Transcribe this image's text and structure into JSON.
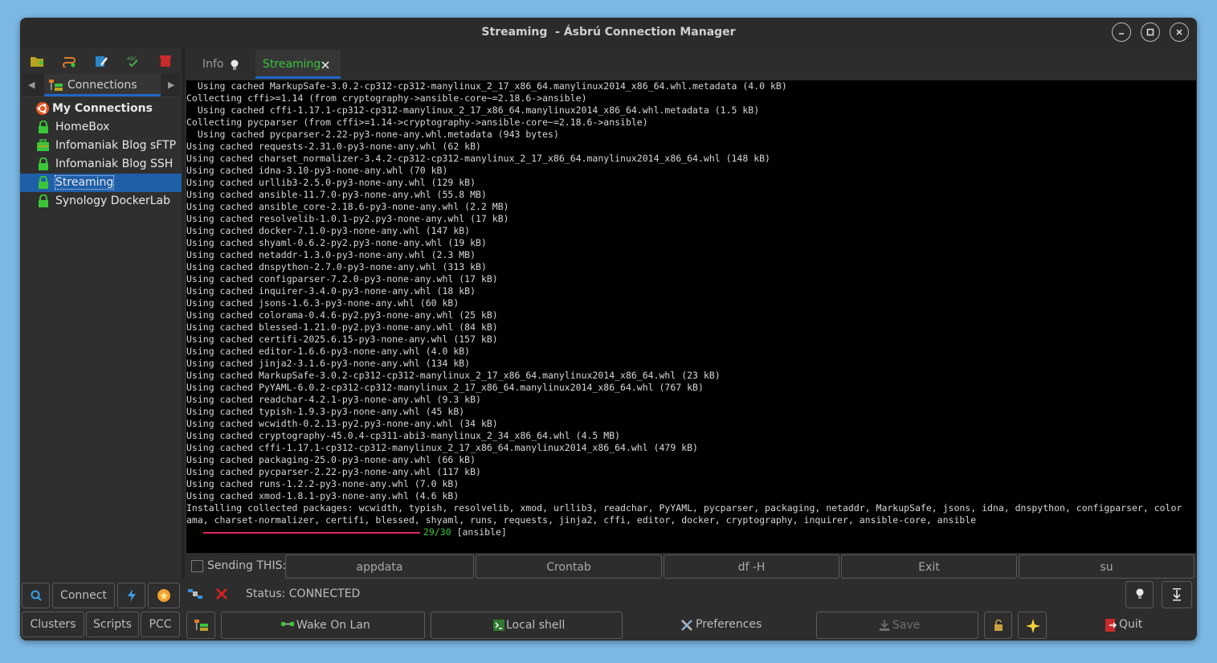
{
  "window": {
    "title": "Streaming  - Ásbrú Connection Manager"
  },
  "sidebar": {
    "tab_label": "Connections",
    "tree": {
      "root": "My Connections",
      "items": [
        {
          "label": "HomeBox",
          "icon": "lock-icon"
        },
        {
          "label": "Infomaniak Blog sFTP",
          "icon": "sftp-icon"
        },
        {
          "label": "Infomaniak Blog SSH",
          "icon": "lock-icon"
        },
        {
          "label": "Streaming",
          "icon": "lock-icon",
          "selected": true
        },
        {
          "label": "Synology DockerLab",
          "icon": "lock-icon"
        }
      ]
    },
    "buttons": {
      "connect": "Connect",
      "clusters": "Clusters",
      "scripts": "Scripts",
      "pcc": "PCC"
    }
  },
  "tabs": [
    {
      "label": "Info",
      "active": false
    },
    {
      "label": "Streaming",
      "active": true
    }
  ],
  "terminal": {
    "lines": [
      "  Using cached MarkupSafe-3.0.2-cp312-cp312-manylinux_2_17_x86_64.manylinux2014_x86_64.whl.metadata (4.0 kB)",
      "Collecting cffi>=1.14 (from cryptography->ansible-core~=2.18.6->ansible)",
      "  Using cached cffi-1.17.1-cp312-cp312-manylinux_2_17_x86_64.manylinux2014_x86_64.whl.metadata (1.5 kB)",
      "Collecting pycparser (from cffi>=1.14->cryptography->ansible-core~=2.18.6->ansible)",
      "  Using cached pycparser-2.22-py3-none-any.whl.metadata (943 bytes)",
      "Using cached requests-2.31.0-py3-none-any.whl (62 kB)",
      "Using cached charset_normalizer-3.4.2-cp312-cp312-manylinux_2_17_x86_64.manylinux2014_x86_64.whl (148 kB)",
      "Using cached idna-3.10-py3-none-any.whl (70 kB)",
      "Using cached urllib3-2.5.0-py3-none-any.whl (129 kB)",
      "Using cached ansible-11.7.0-py3-none-any.whl (55.8 MB)",
      "Using cached ansible_core-2.18.6-py3-none-any.whl (2.2 MB)",
      "Using cached resolvelib-1.0.1-py2.py3-none-any.whl (17 kB)",
      "Using cached docker-7.1.0-py3-none-any.whl (147 kB)",
      "Using cached shyaml-0.6.2-py2.py3-none-any.whl (19 kB)",
      "Using cached netaddr-1.3.0-py3-none-any.whl (2.3 MB)",
      "Using cached dnspython-2.7.0-py3-none-any.whl (313 kB)",
      "Using cached configparser-7.2.0-py3-none-any.whl (17 kB)",
      "Using cached inquirer-3.4.0-py3-none-any.whl (18 kB)",
      "Using cached jsons-1.6.3-py3-none-any.whl (60 kB)",
      "Using cached colorama-0.4.6-py2.py3-none-any.whl (25 kB)",
      "Using cached blessed-1.21.0-py2.py3-none-any.whl (84 kB)",
      "Using cached certifi-2025.6.15-py3-none-any.whl (157 kB)",
      "Using cached editor-1.6.6-py3-none-any.whl (4.0 kB)",
      "Using cached jinja2-3.1.6-py3-none-any.whl (134 kB)",
      "Using cached MarkupSafe-3.0.2-cp312-cp312-manylinux_2_17_x86_64.manylinux2014_x86_64.whl (23 kB)",
      "Using cached PyYAML-6.0.2-cp312-cp312-manylinux_2_17_x86_64.manylinux2014_x86_64.whl (767 kB)",
      "Using cached readchar-4.2.1-py3-none-any.whl (9.3 kB)",
      "Using cached typish-1.9.3-py3-none-any.whl (45 kB)",
      "Using cached wcwidth-0.2.13-py2.py3-none-any.whl (34 kB)",
      "Using cached cryptography-45.0.4-cp311-abi3-manylinux_2_34_x86_64.whl (4.5 MB)",
      "Using cached cffi-1.17.1-cp312-cp312-manylinux_2_17_x86_64.manylinux2014_x86_64.whl (479 kB)",
      "Using cached packaging-25.0-py3-none-any.whl (66 kB)",
      "Using cached pycparser-2.22-py3-none-any.whl (117 kB)",
      "Using cached runs-1.2.2-py3-none-any.whl (7.0 kB)",
      "Using cached xmod-1.8.1-py3-none-any.whl (4.6 kB)",
      "Installing collected packages: wcwidth, typish, resolvelib, xmod, urllib3, readchar, PyYAML, pycparser, packaging, netaddr, MarkupSafe, jsons, idna, dnspython, configparser, color",
      "ama, charset-normalizer, certifi, blessed, shyaml, runs, requests, jinja2, cffi, editor, docker, cryptography, inquirer, ansible-core, ansible"
    ],
    "progress": {
      "count": "29/30",
      "label": "[ansible]",
      "color": "#e0245e"
    }
  },
  "send_bar": {
    "label": "Sending THIS:",
    "buttons": [
      "appdata",
      "Crontab",
      "df -H",
      "Exit",
      "su"
    ]
  },
  "status": {
    "text": "Status: CONNECTED"
  },
  "bottom_bar": {
    "wake_on_lan": "Wake On Lan",
    "local_shell": "Local shell",
    "preferences": "Preferences",
    "save": "Save",
    "quit": "Quit"
  },
  "colors": {
    "accent": "#1e67c9",
    "active_tab_text": "#3ac53a",
    "selection": "#1f5fa8"
  }
}
